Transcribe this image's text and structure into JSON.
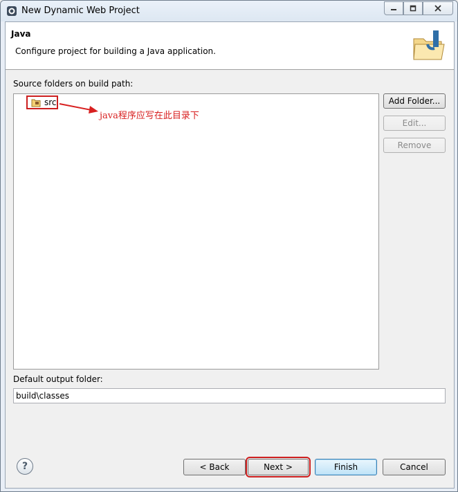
{
  "window": {
    "title": "New Dynamic Web Project"
  },
  "header": {
    "title": "Java",
    "description": "Configure project for building a Java application."
  },
  "source_folders": {
    "label": "Source folders on build path:",
    "items": [
      {
        "label": "src"
      }
    ],
    "annotation": "java程序应写在此目录下"
  },
  "side_buttons": {
    "add_folder": "Add Folder...",
    "edit": "Edit...",
    "remove": "Remove"
  },
  "output_folder": {
    "label": "Default output folder:",
    "value": "build\\classes"
  },
  "footer": {
    "help_icon": "?",
    "back": "< Back",
    "next": "Next >",
    "finish": "Finish",
    "cancel": "Cancel"
  },
  "colors": {
    "annotation": "#cc1e1e",
    "default_button": "#3c7fb1"
  }
}
